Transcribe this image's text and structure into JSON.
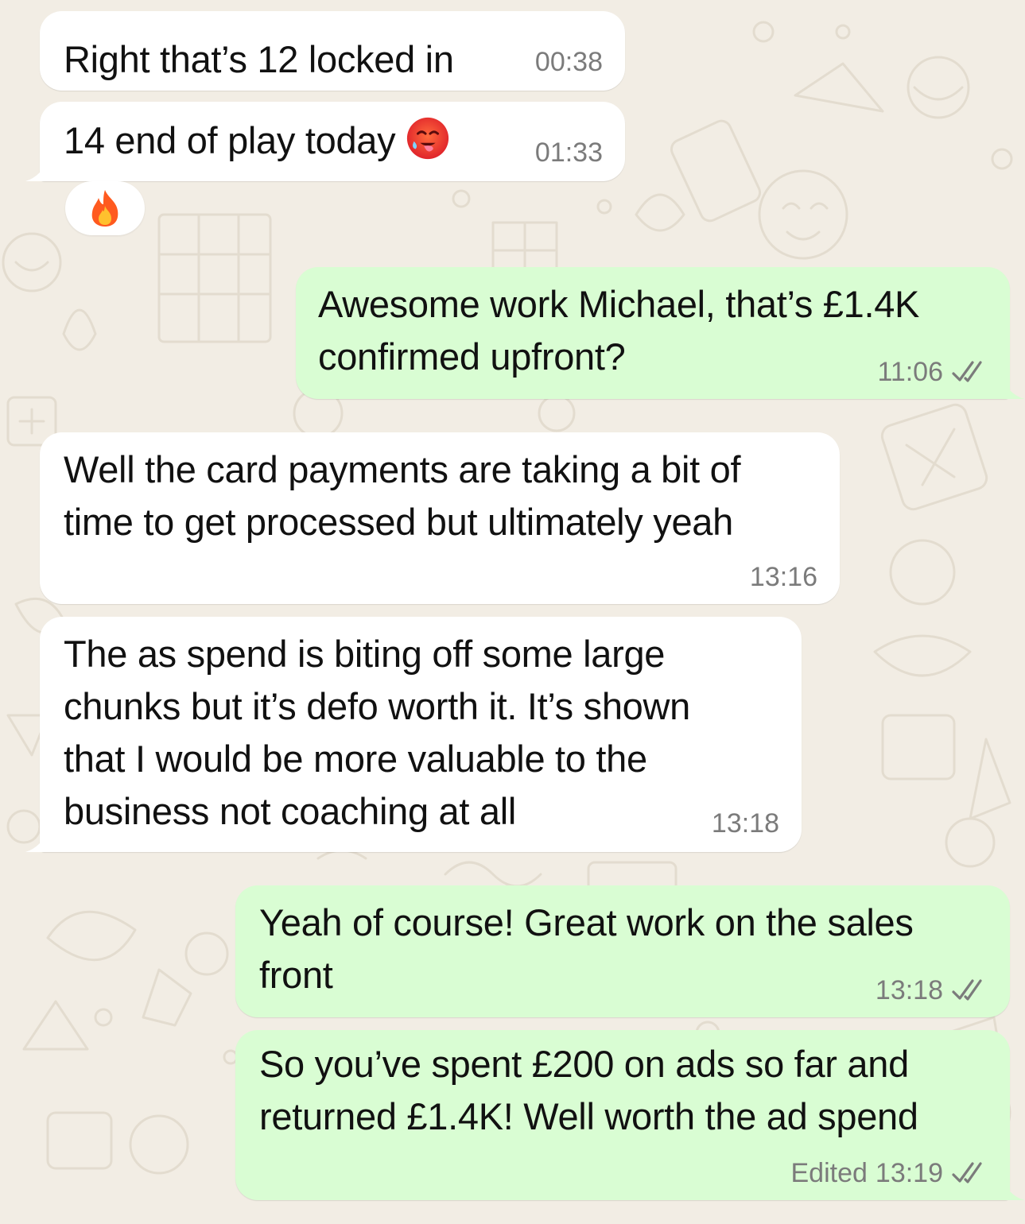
{
  "theme": {
    "wallpaper": "#f2ede4",
    "incoming_bubble": "#ffffff",
    "outgoing_bubble": "#d9fdd3",
    "timestamp_color": "#7b7b7b",
    "read_ticks_color": "#7b7b7b"
  },
  "messages": [
    {
      "direction": "incoming",
      "text": "Right that’s 12 locked in",
      "time": "00:38"
    },
    {
      "direction": "incoming",
      "text": "14 end of play today",
      "emoji": "hot-face-emoji",
      "time": "01:33",
      "reaction": "fire-emoji"
    },
    {
      "direction": "outgoing",
      "text": "Awesome work Michael, that’s £1.4K\nconfirmed upfront?",
      "time": "11:06",
      "status": "read-ticks-icon"
    },
    {
      "direction": "incoming",
      "text": "Well the card payments are taking a bit of\ntime to get processed but ultimately yeah",
      "time": "13:16"
    },
    {
      "direction": "incoming",
      "text": "The as spend is biting off some large\nchunks but it’s defo worth it. It’s shown\nthat I would be more valuable to the\nbusiness not coaching at all",
      "time": "13:18"
    },
    {
      "direction": "outgoing",
      "text": "Yeah of course! Great work on the sales\nfront",
      "time": "13:18",
      "status": "read-ticks-icon"
    },
    {
      "direction": "outgoing",
      "text": "So you’ve spent £200 on ads so far and\nreturned £1.4K! Well worth the ad spend",
      "edited_label": "Edited",
      "time": "13:19",
      "status": "read-ticks-icon"
    }
  ]
}
